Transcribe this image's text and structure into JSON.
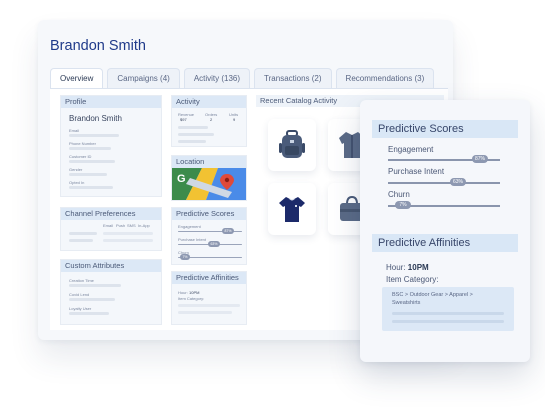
{
  "customer": {
    "name": "Brandon Smith"
  },
  "tabs": [
    {
      "label": "Overview",
      "active": true
    },
    {
      "label": "Campaigns (4)",
      "active": false
    },
    {
      "label": "Activity (136)",
      "active": false
    },
    {
      "label": "Transactions (2)",
      "active": false
    },
    {
      "label": "Recommendations (3)",
      "active": false
    }
  ],
  "profile": {
    "title": "Profile",
    "name": "Brandon Smith",
    "fields": [
      "Email",
      "Phone Number",
      "Customer ID",
      "Gender",
      "Opted In"
    ]
  },
  "activity": {
    "title": "Activity",
    "stats": [
      {
        "label": "Revenue",
        "value": "$97"
      },
      {
        "label": "Orders",
        "value": "2"
      },
      {
        "label": "Units",
        "value": "9"
      }
    ]
  },
  "location": {
    "title": "Location"
  },
  "catalog": {
    "title": "Recent Catalog Activity"
  },
  "channel_preferences": {
    "title": "Channel Preferences",
    "columns": [
      "Email",
      "Push",
      "SMS",
      "In-App"
    ]
  },
  "custom_attributes": {
    "title": "Custom Attributes",
    "fields": [
      "Creation Time",
      "Covid Lend",
      "Loyalty User"
    ]
  },
  "predictive_scores_small": {
    "title": "Predictive Scores",
    "items": [
      {
        "label": "Engagement",
        "value": "87%"
      },
      {
        "label": "Purchase Intent",
        "value": "63%"
      },
      {
        "label": "Churn",
        "value": "7%"
      }
    ]
  },
  "predictive_affinities_small": {
    "title": "Predictive Affinities",
    "hour_label": "Hour:",
    "hour_value": "10PM",
    "category_label": "Item Category:"
  },
  "predictive_scores": {
    "title": "Predictive Scores",
    "items": [
      {
        "label": "Engagement",
        "value": "87%",
        "level": 0.87
      },
      {
        "label": "Purchase Intent",
        "value": "63%",
        "level": 0.63
      },
      {
        "label": "Churn",
        "value": "7%",
        "level": 0.07
      }
    ]
  },
  "predictive_affinities": {
    "title": "Predictive Affinities",
    "hour_label": "Hour:",
    "hour_value": "10PM",
    "category_label": "Item Category:",
    "category_path": "BSC > Outdoor Gear > Apparel > Sweatshirts"
  },
  "colors": {
    "accent": "#1f3a8a",
    "header_fill": "#d9e7f6",
    "pill": "#8d98b1"
  },
  "icons": [
    "backpack-icon",
    "shirt-icon",
    "tshirt-icon",
    "bag-icon",
    "map-icon",
    "map-pin-icon"
  ]
}
